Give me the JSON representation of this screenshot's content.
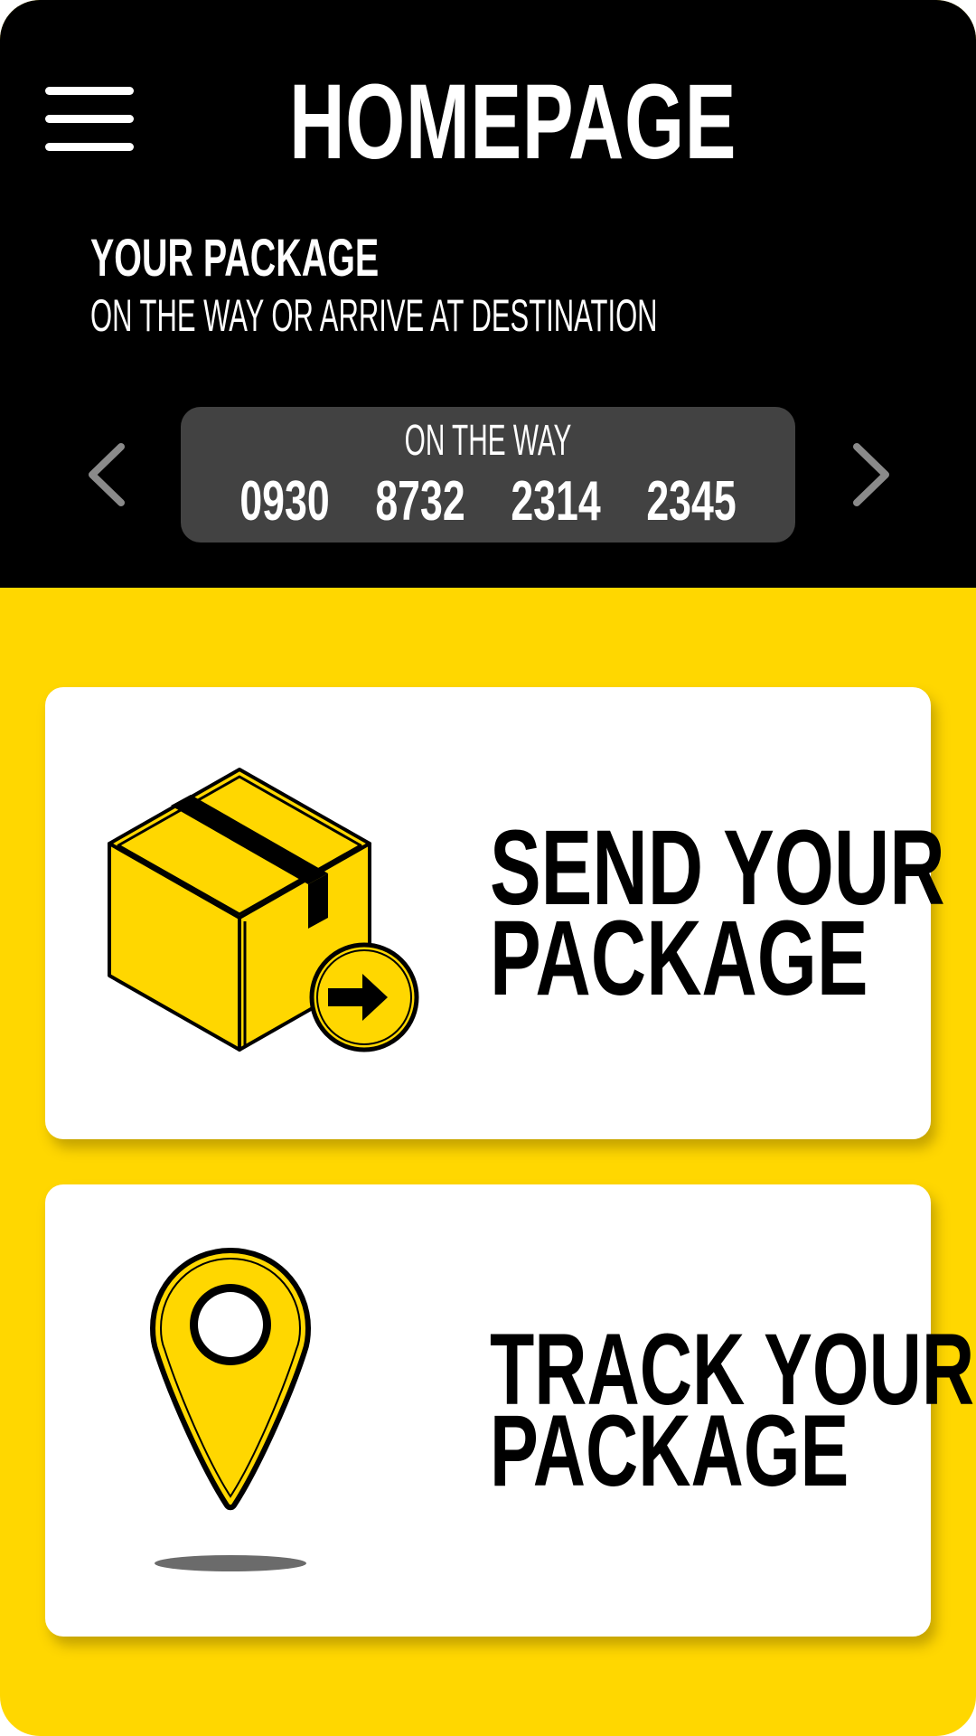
{
  "app": {
    "title": "HOMEPAGE"
  },
  "header": {
    "menu_icon": "hamburger-menu-icon",
    "status_heading": "YOUR PACKAGE",
    "status_subheading": "ON THE WAY OR ARRIVE AT DESTINATION",
    "prev_icon": "chevron-left-icon",
    "next_icon": "chevron-right-icon"
  },
  "tracking": {
    "status": "ON THE WAY",
    "number_groups": [
      "0930",
      "8732",
      "2314",
      "2345"
    ]
  },
  "actions": {
    "send": {
      "icon": "package-box-send-icon",
      "label_line1": "SEND YOUR",
      "label_line2": "PACKAGE"
    },
    "track": {
      "icon": "location-pin-icon",
      "label_line1": "TRACK YOUR",
      "label_line2": "PACKAGE"
    }
  },
  "colors": {
    "brand_yellow": "#FFD700",
    "header_black": "#000000",
    "tracking_card_gray": "#424242",
    "arrow_gray": "#8A8A8A",
    "card_white": "#FFFFFF"
  }
}
